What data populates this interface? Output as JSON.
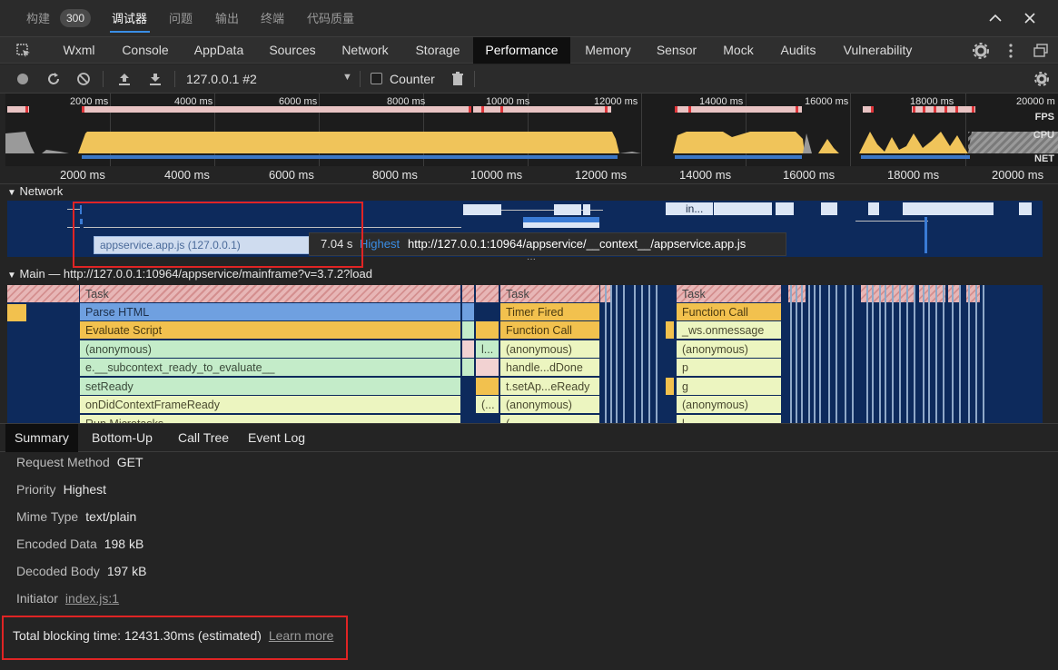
{
  "top": {
    "tabs": [
      {
        "label": "构建"
      },
      {
        "label": "调试器"
      },
      {
        "label": "问题"
      },
      {
        "label": "输出"
      },
      {
        "label": "终端"
      },
      {
        "label": "代码质量"
      }
    ],
    "build_badge": "300"
  },
  "devtools_tabs": [
    "Wxml",
    "Console",
    "AppData",
    "Sources",
    "Network",
    "Storage",
    "Performance",
    "Memory",
    "Sensor",
    "Mock",
    "Audits",
    "Vulnerability"
  ],
  "active_devtools_tab": "Performance",
  "perf_toolbar": {
    "target": "127.0.0.1 #2",
    "counter_label": "Counter",
    "counter_checked": false
  },
  "overview": {
    "ticks": [
      "2000 ms",
      "4000 ms",
      "6000 ms",
      "8000 ms",
      "10000 ms",
      "12000 ms",
      "14000 ms",
      "16000 ms",
      "18000 ms",
      "20000 m"
    ],
    "labels": {
      "fps": "FPS",
      "cpu": "CPU",
      "net": "NET"
    }
  },
  "ruler_ticks": [
    "2000 ms",
    "4000 ms",
    "6000 ms",
    "8000 ms",
    "10000 ms",
    "12000 ms",
    "14000 ms",
    "16000 ms",
    "18000 ms",
    "20000 ms"
  ],
  "network": {
    "title": "Network",
    "request_chip": "appservice.app.js (127.0.0.1)",
    "in_label": "in...",
    "tooltip": {
      "time": "7.04 s",
      "priority": "Highest",
      "url": "http://127.0.0.1:10964/appservice/__context__/appservice.app.js"
    }
  },
  "main": {
    "title": "Main — http://127.0.0.1:10964/appservice/mainframe?v=3.7.2?load",
    "col1": [
      "Task",
      "Parse HTML",
      "Evaluate Script",
      "(anonymous)",
      "e.__subcontext_ready_to_evaluate__",
      "setReady",
      "onDidContextFrameReady",
      "Run Microtasks"
    ],
    "col2": [
      "Task",
      "Timer Fired",
      "Function Call",
      "(anonymous)",
      "handle...dDone",
      "t.setAp...eReady",
      "(anonymous)",
      "(."
    ],
    "col3": [
      "Task",
      "Function Call",
      "_ws.onmessage",
      "(anonymous)",
      "p",
      "g",
      "(anonymous)",
      "l"
    ],
    "small": [
      "l...",
      "(..."
    ]
  },
  "subtabs": [
    "Summary",
    "Bottom-Up",
    "Call Tree",
    "Event Log"
  ],
  "summary": {
    "rows": [
      {
        "key": "Request Method",
        "value": "GET"
      },
      {
        "key": "Priority",
        "value": "Highest"
      },
      {
        "key": "Mime Type",
        "value": "text/plain"
      },
      {
        "key": "Encoded Data",
        "value": "198 kB"
      },
      {
        "key": "Decoded Body",
        "value": "197 kB"
      }
    ],
    "initiator_key": "Initiator",
    "initiator_link": "index.js:1",
    "tbt_text": "Total blocking time: 12431.30ms (estimated)",
    "tbt_link": "Learn more"
  }
}
